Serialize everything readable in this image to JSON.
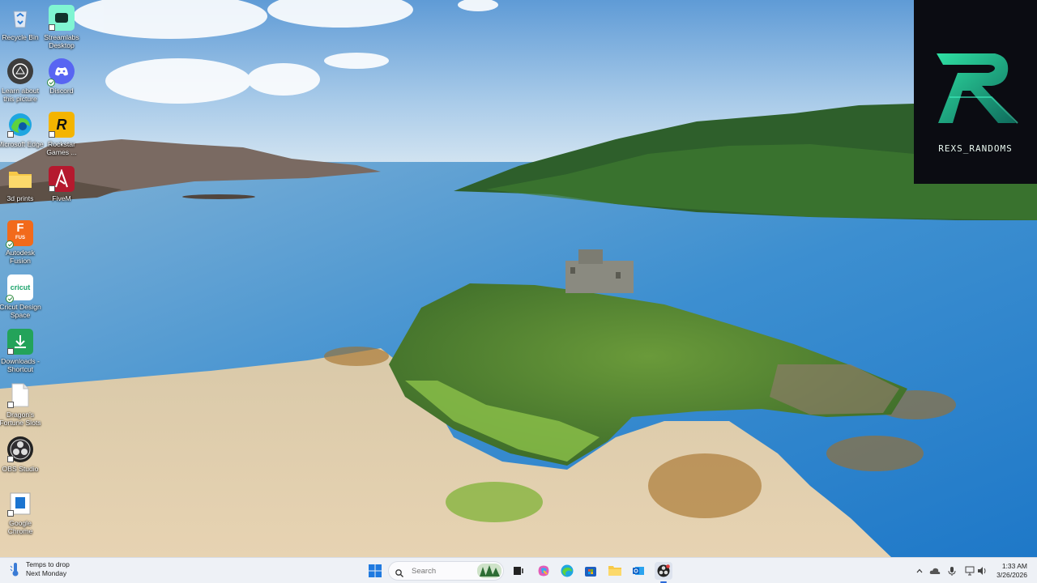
{
  "desktop": {
    "icons": [
      {
        "label": "Recycle Bin",
        "icon": "recycle-bin-icon"
      },
      {
        "label": "Streamlabs Desktop",
        "icon": "streamlabs-icon"
      },
      {
        "label": "Learn about this picture",
        "icon": "learn-picture-icon"
      },
      {
        "label": "Discord",
        "icon": "discord-icon"
      },
      {
        "label": "Microsoft Edge",
        "icon": "edge-icon"
      },
      {
        "label": "Rockstar Games ...",
        "icon": "rockstar-icon"
      },
      {
        "label": "3d prints",
        "icon": "folder-icon"
      },
      {
        "label": "FiveM",
        "icon": "fivem-icon"
      },
      {
        "label": "Autodesk Fusion",
        "icon": "fusion-icon"
      },
      {
        "label": "Cricut Design Space",
        "icon": "cricut-icon"
      },
      {
        "label": "Downloads - Shortcut",
        "icon": "downloads-icon"
      },
      {
        "label": "Dragon's Fortune Slots",
        "icon": "file-icon"
      },
      {
        "label": "OBS Studio",
        "icon": "obs-icon"
      },
      {
        "label": "Google Chrome",
        "icon": "chrome-doc-icon"
      }
    ],
    "fusion_glyph": "F",
    "fusion_tag": "FUS",
    "cricut_glyph": "cricut",
    "rockstar_glyph": "R"
  },
  "overlay": {
    "name": "REXS_RANDOMS"
  },
  "taskbar": {
    "weather": {
      "line1": "Temps to drop",
      "line2": "Next Monday"
    },
    "search": {
      "placeholder": "Search"
    },
    "clock": {
      "time": "1:33 AM",
      "date": "3/26/2026"
    },
    "colors": {
      "accent": "#2a6ad8",
      "background": "#eef1f6"
    }
  }
}
